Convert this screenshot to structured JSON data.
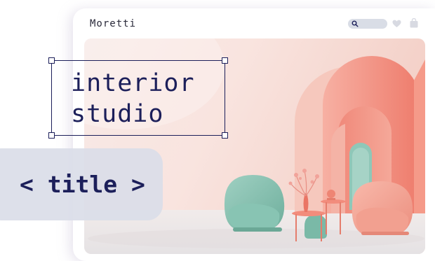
{
  "brand": {
    "name": "Moretti"
  },
  "header_icons": {
    "search": "search-icon",
    "favorite": "heart-icon",
    "cart": "shopping-bag-icon"
  },
  "hero": {
    "headline_line1": "interior",
    "headline_line2": "studio",
    "image_subject": "pink arched interior with mint and pink armchairs"
  },
  "tag": {
    "label": "< title >"
  },
  "colors": {
    "accent": "#1c1f5a",
    "tag_bg": "#dadde8",
    "arch": "#f08272",
    "chair_mint": "#7fbfae",
    "chair_pink": "#f3a596"
  }
}
